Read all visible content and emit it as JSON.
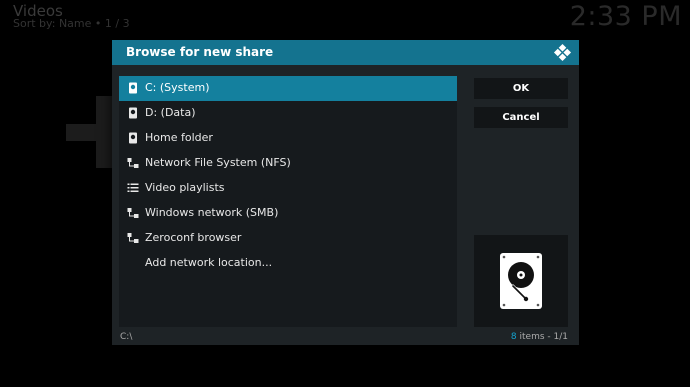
{
  "background": {
    "title": "Videos",
    "sort": "Sort by: Name • 1 / 3",
    "clock": "2:33 PM"
  },
  "dialog": {
    "title": "Browse for new share",
    "items": [
      {
        "label": "C: (System)",
        "icon": "drive-icon",
        "selected": true
      },
      {
        "label": "D: (Data)",
        "icon": "drive-icon",
        "selected": false
      },
      {
        "label": "Home folder",
        "icon": "drive-icon",
        "selected": false
      },
      {
        "label": "Network File System (NFS)",
        "icon": "network-icon",
        "selected": false
      },
      {
        "label": "Video playlists",
        "icon": "playlist-icon",
        "selected": false
      },
      {
        "label": "Windows network (SMB)",
        "icon": "network-icon",
        "selected": false
      },
      {
        "label": "Zeroconf browser",
        "icon": "network-icon",
        "selected": false
      },
      {
        "label": "Add network location...",
        "icon": "",
        "selected": false
      }
    ],
    "ok_label": "OK",
    "cancel_label": "Cancel",
    "preview_icon": "hard-drive-icon",
    "path": "C:\\",
    "item_count": "8",
    "item_count_suffix": " items - 1/1"
  },
  "colors": {
    "accent": "#14738f",
    "selected": "#14809e",
    "count_highlight": "#14a3d0"
  }
}
